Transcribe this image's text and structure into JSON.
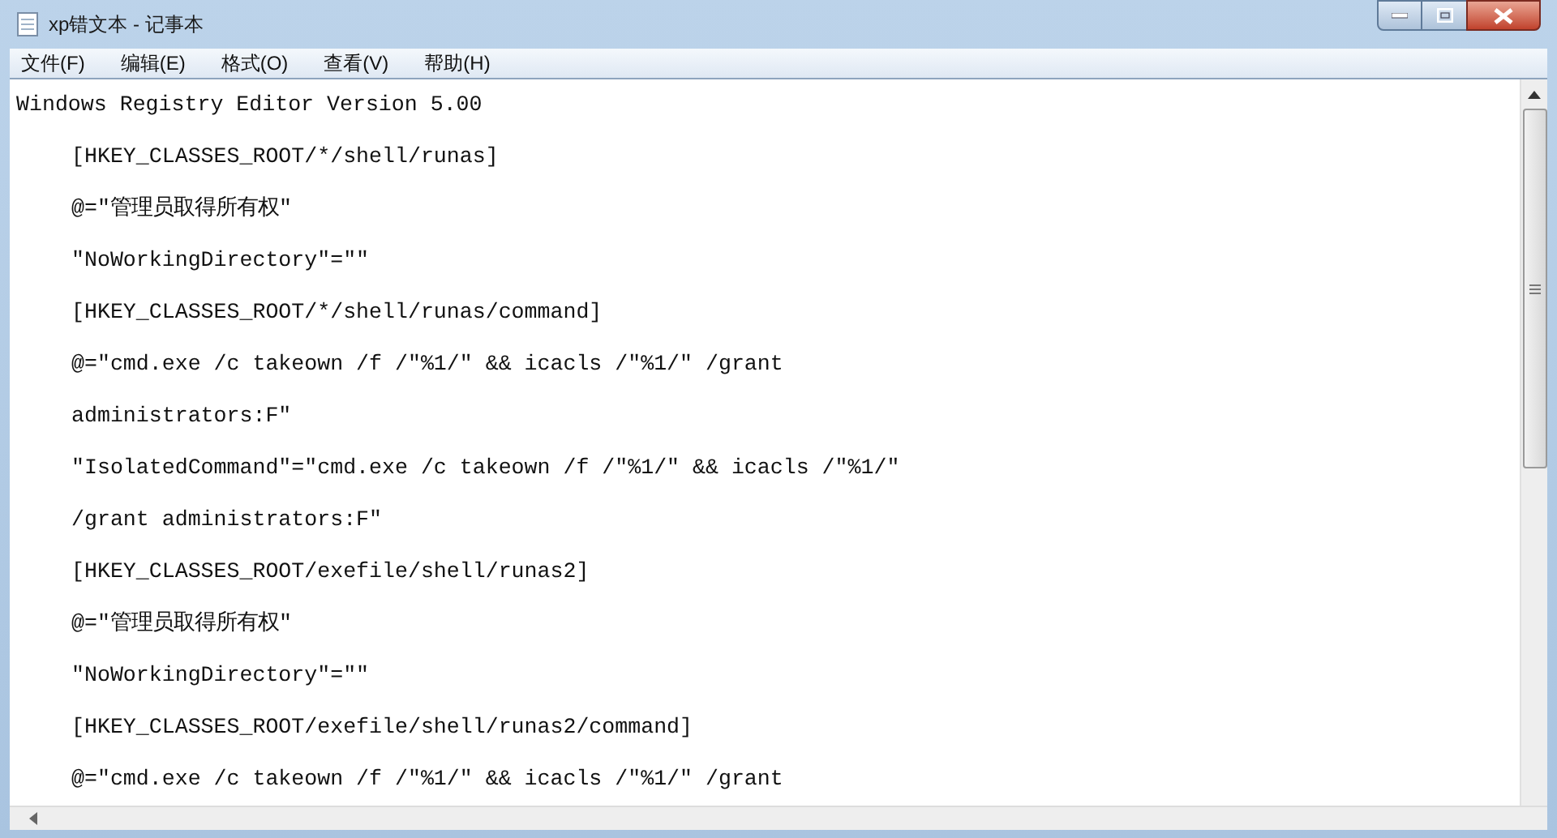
{
  "window": {
    "title": "xp错文本 - 记事本"
  },
  "menu": [
    {
      "label": "文件(F)"
    },
    {
      "label": "编辑(E)"
    },
    {
      "label": "格式(O)"
    },
    {
      "label": "查看(V)"
    },
    {
      "label": "帮助(H)"
    }
  ],
  "lines": [
    {
      "text": "Windows Registry Editor Version 5.00",
      "indented": false
    },
    {
      "text": "[HKEY_CLASSES_ROOT/*/shell/runas]",
      "indented": true
    },
    {
      "text": "@=\"管理员取得所有权\"",
      "indented": true
    },
    {
      "text": "\"NoWorkingDirectory\"=\"\"",
      "indented": true
    },
    {
      "text": "[HKEY_CLASSES_ROOT/*/shell/runas/command]",
      "indented": true
    },
    {
      "text": "@=\"cmd.exe /c takeown /f /\"%1/\" && icacls /\"%1/\" /grant",
      "indented": true
    },
    {
      "text": "administrators:F\"",
      "indented": true
    },
    {
      "text": "\"IsolatedCommand\"=\"cmd.exe /c takeown /f /\"%1/\" && icacls /\"%1/\"",
      "indented": true
    },
    {
      "text": "/grant administrators:F\"",
      "indented": true
    },
    {
      "text": "[HKEY_CLASSES_ROOT/exefile/shell/runas2]",
      "indented": true
    },
    {
      "text": "@=\"管理员取得所有权\"",
      "indented": true
    },
    {
      "text": "\"NoWorkingDirectory\"=\"\"",
      "indented": true
    },
    {
      "text": "[HKEY_CLASSES_ROOT/exefile/shell/runas2/command]",
      "indented": true
    },
    {
      "text": "@=\"cmd.exe /c takeown /f /\"%1/\" && icacls /\"%1/\" /grant",
      "indented": true
    }
  ]
}
